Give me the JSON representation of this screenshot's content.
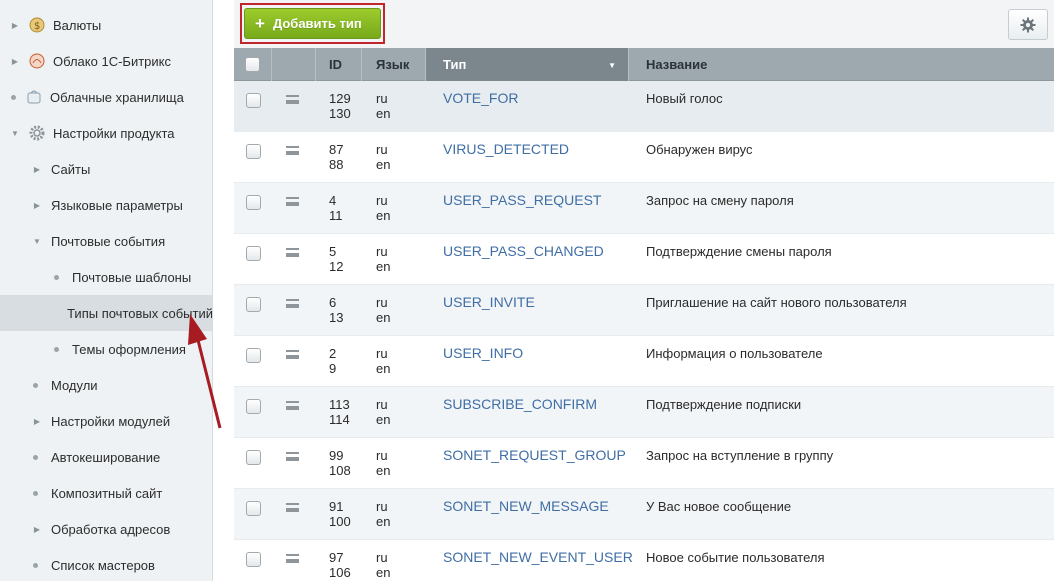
{
  "sidebar": {
    "items": [
      {
        "label": "Валюты",
        "marker": "arrow",
        "icon": "currency-icon"
      },
      {
        "label": "Облако 1С-Битрикс",
        "marker": "arrow",
        "icon": "cloud-bitrix-icon"
      },
      {
        "label": "Облачные хранилища",
        "marker": "dot",
        "icon": "cloud-storage-icon"
      },
      {
        "label": "Настройки продукта",
        "marker": "arrow-down",
        "icon": "gear-icon"
      },
      {
        "label": "Сайты",
        "marker": "arrow"
      },
      {
        "label": "Языковые параметры",
        "marker": "arrow"
      },
      {
        "label": "Почтовые события",
        "marker": "arrow-down"
      },
      {
        "label": "Почтовые шаблоны",
        "marker": "dot"
      },
      {
        "label": "Типы почтовых событий",
        "marker": "dot",
        "active": true
      },
      {
        "label": "Темы оформления",
        "marker": "dot"
      },
      {
        "label": "Модули",
        "marker": "dot"
      },
      {
        "label": "Настройки модулей",
        "marker": "arrow"
      },
      {
        "label": "Автокеширование",
        "marker": "dot"
      },
      {
        "label": "Композитный сайт",
        "marker": "dot"
      },
      {
        "label": "Обработка адресов",
        "marker": "arrow"
      },
      {
        "label": "Список мастеров",
        "marker": "dot"
      }
    ]
  },
  "toolbar": {
    "add_label": "Добавить тип",
    "settings_icon": "gear-icon"
  },
  "table": {
    "headers": {
      "id": "ID",
      "lang": "Язык",
      "type": "Тип",
      "name": "Название"
    },
    "sorted_column": "type",
    "rows": [
      {
        "id1": "129",
        "id2": "130",
        "lang1": "ru",
        "lang2": "en",
        "type": "VOTE_FOR",
        "name": "Новый голос"
      },
      {
        "id1": "87",
        "id2": "88",
        "lang1": "ru",
        "lang2": "en",
        "type": "VIRUS_DETECTED",
        "name": "Обнаружен вирус"
      },
      {
        "id1": "4",
        "id2": "11",
        "lang1": "ru",
        "lang2": "en",
        "type": "USER_PASS_REQUEST",
        "name": "Запрос на смену пароля"
      },
      {
        "id1": "5",
        "id2": "12",
        "lang1": "ru",
        "lang2": "en",
        "type": "USER_PASS_CHANGED",
        "name": "Подтверждение смены пароля"
      },
      {
        "id1": "6",
        "id2": "13",
        "lang1": "ru",
        "lang2": "en",
        "type": "USER_INVITE",
        "name": "Приглашение на сайт нового пользователя"
      },
      {
        "id1": "2",
        "id2": "9",
        "lang1": "ru",
        "lang2": "en",
        "type": "USER_INFO",
        "name": "Информация о пользователе"
      },
      {
        "id1": "113",
        "id2": "114",
        "lang1": "ru",
        "lang2": "en",
        "type": "SUBSCRIBE_CONFIRM",
        "name": "Подтверждение подписки"
      },
      {
        "id1": "99",
        "id2": "108",
        "lang1": "ru",
        "lang2": "en",
        "type": "SONET_REQUEST_GROUP",
        "name": "Запрос на вступление в группу"
      },
      {
        "id1": "91",
        "id2": "100",
        "lang1": "ru",
        "lang2": "en",
        "type": "SONET_NEW_MESSAGE",
        "name": "У Вас новое сообщение"
      },
      {
        "id1": "97",
        "id2": "106",
        "lang1": "ru",
        "lang2": "en",
        "type": "SONET_NEW_EVENT_USER",
        "name": "Новое событие пользователя"
      }
    ]
  },
  "colors": {
    "add_button": "#86b923",
    "highlight_frame": "#c0262c",
    "annotation_arrow": "#a61c22",
    "link": "#3f6ea5"
  }
}
